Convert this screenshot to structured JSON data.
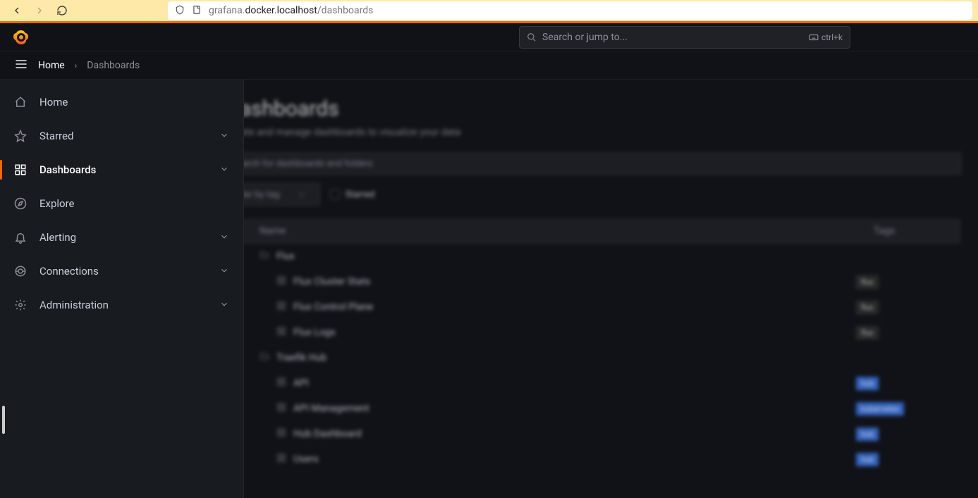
{
  "browser": {
    "url_pre": "grafana.",
    "url_host": "docker.localhost",
    "url_path": "/dashboards"
  },
  "header": {
    "search_placeholder": "Search or jump to...",
    "shortcut": "ctrl+k"
  },
  "breadcrumbs": {
    "home": "Home",
    "sep": "›",
    "current": "Dashboards"
  },
  "sidebar": {
    "items": [
      {
        "label": "Home",
        "icon": "home",
        "expandable": false,
        "active": false
      },
      {
        "label": "Starred",
        "icon": "star",
        "expandable": true,
        "active": false
      },
      {
        "label": "Dashboards",
        "icon": "apps",
        "expandable": true,
        "active": true
      },
      {
        "label": "Explore",
        "icon": "compass",
        "expandable": false,
        "active": false
      },
      {
        "label": "Alerting",
        "icon": "bell",
        "expandable": true,
        "active": false
      },
      {
        "label": "Connections",
        "icon": "link",
        "expandable": true,
        "active": false
      },
      {
        "label": "Administration",
        "icon": "gear",
        "expandable": true,
        "active": false
      }
    ]
  },
  "page": {
    "title": "Dashboards",
    "subtitle": "Create and manage dashboards to visualize your data",
    "search_ph": "Search for dashboards and folders",
    "filter_tag": "Filter by tag",
    "starred_label": "Starred",
    "col_name": "Name",
    "col_tags": "Tags"
  },
  "rows": [
    {
      "type": "folder",
      "name": "Flux",
      "tags": []
    },
    {
      "type": "dash",
      "name": "Flux Cluster Stats",
      "tags": [
        {
          "text": "flux",
          "color": "dark"
        }
      ]
    },
    {
      "type": "dash",
      "name": "Flux Control Plane",
      "tags": [
        {
          "text": "flux",
          "color": "dark"
        }
      ]
    },
    {
      "type": "dash",
      "name": "Flux Logs",
      "tags": [
        {
          "text": "flux",
          "color": "dark"
        }
      ]
    },
    {
      "type": "folder",
      "name": "Traefik Hub",
      "tags": []
    },
    {
      "type": "dash",
      "name": "API",
      "tags": [
        {
          "text": "hub",
          "color": "blue"
        }
      ]
    },
    {
      "type": "dash",
      "name": "API Management",
      "tags": [
        {
          "text": "kubernetes",
          "color": "blue"
        }
      ]
    },
    {
      "type": "dash",
      "name": "Hub Dashboard",
      "tags": [
        {
          "text": "hub",
          "color": "blue"
        }
      ]
    },
    {
      "type": "dash",
      "name": "Users",
      "tags": [
        {
          "text": "hub",
          "color": "blue"
        }
      ]
    }
  ]
}
